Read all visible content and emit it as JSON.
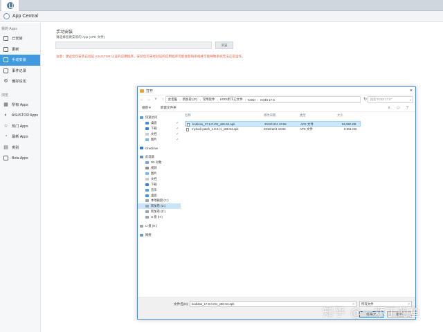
{
  "app": {
    "title": "App Central"
  },
  "sidebar": {
    "section_my": "我的 Apps",
    "my_items": [
      {
        "label": "已安装",
        "icon": "installed-icon"
      },
      {
        "label": "更新",
        "icon": "update-icon"
      },
      {
        "label": "手动安装",
        "icon": "manual-install-icon",
        "active": true
      },
      {
        "label": "事件记录",
        "icon": "event-log-icon"
      },
      {
        "label": "偏好设定",
        "icon": "gear-icon"
      }
    ],
    "section_browse": "浏览",
    "browse_items": [
      {
        "label": "所有 Apps",
        "icon": "all-apps-icon"
      },
      {
        "label": "ASUSTOR Apps",
        "icon": "asustor-icon"
      },
      {
        "label": "热门 Apps",
        "icon": "star-icon"
      },
      {
        "label": "最新 Apps",
        "icon": "new-icon"
      },
      {
        "label": "类别",
        "icon": "category-icon"
      },
      {
        "label": "Beta Apps",
        "icon": "beta-icon"
      }
    ]
  },
  "main": {
    "title": "手动安装",
    "subtitle": "请选择您要安装的 App (APK 文件)",
    "file_value": "",
    "browse_label": "浏览",
    "warning": "注意：建议您仅安装已验证 ASUSTOR 认证的应用程序。安装您可未经验证的应用程序可能会影响系统并可能导致系统无法正常运作。"
  },
  "dialog": {
    "title": "打开",
    "breadcrumbs": [
      "此电脑",
      "新加卷 (D:)",
      "常用软件",
      "KODI用下它文件",
      "KODI",
      "KODI 17.6"
    ],
    "search_placeholder": "搜索\"KODI 17.6\"",
    "organize_label": "组织 ▾",
    "new_folder_label": "新建文件夹",
    "tree": {
      "quick_access": "快速访问",
      "quick_items": [
        "桌面",
        "下载",
        "文档",
        "图片"
      ],
      "onedrive": "OneDrive",
      "this_pc": "此电脑",
      "pc_items": [
        "3D 对象",
        "视频",
        "图片",
        "文档",
        "下载",
        "音乐",
        "桌面",
        "本地磁盘 (C:)",
        "新加卷 (D:)",
        "新加卷 (E:)",
        "U 盘 (H:)"
      ],
      "usb": "U 盘 (H:)",
      "network": "网络"
    },
    "columns": {
      "name": "名称",
      "modified": "修改日期",
      "type": "类型",
      "size": "大小"
    },
    "files": [
      {
        "name": "kodi4as_17.6.0.r01_x86-64.apk",
        "modified": "2018/12/4 19:56",
        "type": "APK 文件",
        "size": "56,990 KB",
        "selected": true
      },
      {
        "name": "mykodi-patch_1.0.0.r1_x86-64.apk",
        "modified": "2018/12/4 19:56",
        "type": "APK 文件",
        "size": "8,951 KB",
        "selected": false
      }
    ],
    "filename_label": "文件名(N):",
    "filename_value": "kodi4as_17.6.0.r01_x86-64.apk",
    "filetype_value": "所有文件",
    "open_label": "打开(O)",
    "cancel_label": "取消"
  },
  "watermark": "知乎 @一颗丁的鱼",
  "colors": {
    "accent": "#3f9ae0",
    "warning": "#e8583b",
    "selection": "#cce8ff"
  }
}
